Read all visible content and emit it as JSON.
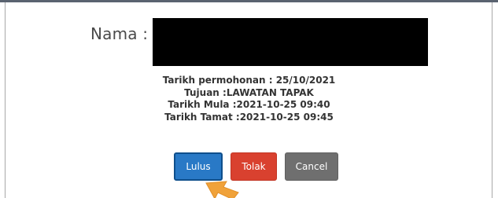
{
  "form": {
    "name_label": "Nama :"
  },
  "details": {
    "line1": "Tarikh permohonan : 25/10/2021",
    "line2": "Tujuan :LAWATAN TAPAK",
    "line3": "Tarikh Mula :2021-10-25 09:40",
    "line4": "Tarikh Tamat :2021-10-25 09:45"
  },
  "buttons": {
    "approve_label": "Lulus",
    "reject_label": "Tolak",
    "cancel_label": "Cancel"
  },
  "colors": {
    "approve": "#2979c6",
    "reject": "#d9412f",
    "cancel": "#6f6f6f",
    "pointer": "#f0a23a"
  },
  "icons": {
    "pointer": "arrow-cursor-icon"
  }
}
